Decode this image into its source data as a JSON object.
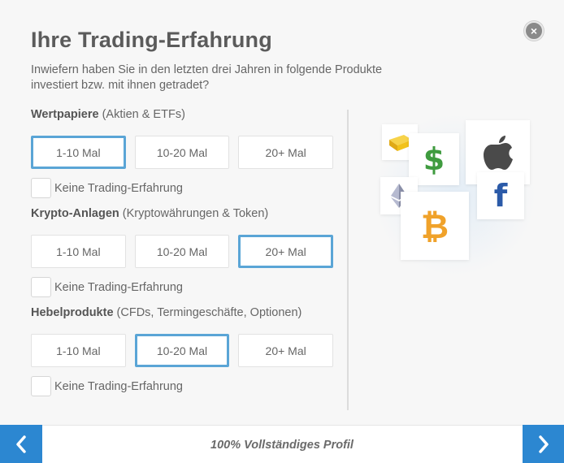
{
  "header": {
    "title": "Ihre Trading-Erfahrung",
    "subtitle": "Inwiefern haben Sie in den letzten drei Jahren in folgende Produkte investiert bzw. mit ihnen getradet?",
    "close_glyph": "×"
  },
  "sections": [
    {
      "name": "Wertpapiere",
      "detail": " (Aktien & ETFs)",
      "options": [
        "1-10 Mal",
        "10-20 Mal",
        "20+ Mal"
      ],
      "selected": "1-10 Mal",
      "no_experience_label": "Keine Trading-Erfahrung",
      "no_experience_checked": false
    },
    {
      "name": "Krypto-Anlagen",
      "detail": " (Kryptowährungen & Token)",
      "options": [
        "1-10 Mal",
        "10-20 Mal",
        "20+ Mal"
      ],
      "selected": "20+ Mal",
      "no_experience_label": "Keine Trading-Erfahrung",
      "no_experience_checked": false
    },
    {
      "name": "Hebelprodukte",
      "detail": " (CFDs, Termingeschäfte, Optionen)",
      "options": [
        "1-10 Mal",
        "10-20 Mal",
        "20+ Mal"
      ],
      "selected": "10-20 Mal",
      "no_experience_label": "Keine Trading-Erfahrung",
      "no_experience_checked": false
    }
  ],
  "illustration": {
    "icons": [
      "gold-bar-icon",
      "dollar-icon",
      "apple-icon",
      "ethereum-icon",
      "bitcoin-icon",
      "facebook-icon"
    ],
    "dollar_glyph": "$",
    "bitcoin_glyph": "₿",
    "facebook_glyph": "f"
  },
  "footer": {
    "progress_text": "100% Vollständiges Profil",
    "progress": 1.0
  },
  "colors": {
    "accent": "#2c87d1",
    "selected_border": "#5aa5d6",
    "dollar_green": "#3f9b3f",
    "bitcoin_orange": "#f0a22a",
    "facebook_blue": "#2b5aa8",
    "gold": "#f2c21a"
  }
}
